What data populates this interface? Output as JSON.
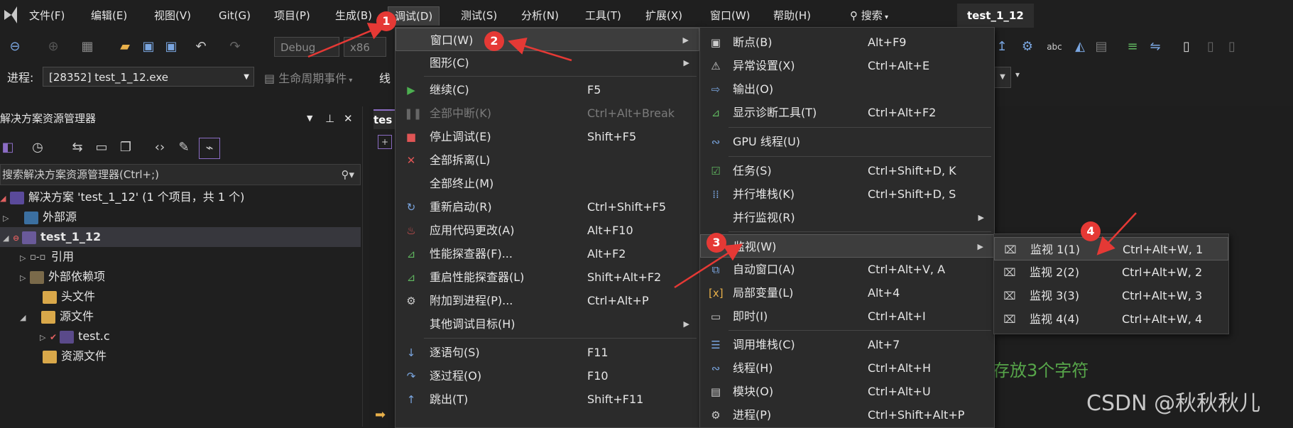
{
  "menubar": {
    "items": [
      "文件(F)",
      "编辑(E)",
      "视图(V)",
      "Git(G)",
      "项目(P)",
      "生成(B)",
      "调试(D)",
      "测试(S)",
      "分析(N)",
      "工具(T)",
      "扩展(X)",
      "窗口(W)",
      "帮助(H)"
    ],
    "search": "搜索",
    "project_title": "test_1_12"
  },
  "toolbar": {
    "config": "Debug",
    "platform": "x86",
    "process_label": "进程:",
    "process_value": "[28352] test_1_12.exe",
    "lifecycle": "生命周期事件",
    "thread_prefix": "线"
  },
  "solution_explorer": {
    "title": "解决方案资源管理器",
    "search_placeholder": "搜索解决方案资源管理器(Ctrl+;)",
    "items": [
      "解决方案 'test_1_12' (1 个项目，共 1 个)",
      "外部源",
      "test_1_12",
      "引用",
      "外部依赖项",
      "头文件",
      "源文件",
      "test.c",
      "资源文件"
    ]
  },
  "editor": {
    "tab_prefix": "tes",
    "comment_fragment": "存放3个字符"
  },
  "debug_menu": {
    "items": [
      {
        "label": "窗口(W)",
        "shortcut": ""
      },
      {
        "label": "图形(C)",
        "shortcut": ""
      },
      {
        "label": "继续(C)",
        "shortcut": "F5"
      },
      {
        "label": "全部中断(K)",
        "shortcut": "Ctrl+Alt+Break"
      },
      {
        "label": "停止调试(E)",
        "shortcut": "Shift+F5"
      },
      {
        "label": "全部拆离(L)",
        "shortcut": ""
      },
      {
        "label": "全部终止(M)",
        "shortcut": ""
      },
      {
        "label": "重新启动(R)",
        "shortcut": "Ctrl+Shift+F5"
      },
      {
        "label": "应用代码更改(A)",
        "shortcut": "Alt+F10"
      },
      {
        "label": "性能探查器(F)...",
        "shortcut": "Alt+F2"
      },
      {
        "label": "重启性能探查器(L)",
        "shortcut": "Shift+Alt+F2"
      },
      {
        "label": "附加到进程(P)...",
        "shortcut": "Ctrl+Alt+P"
      },
      {
        "label": "其他调试目标(H)",
        "shortcut": ""
      },
      {
        "label": "逐语句(S)",
        "shortcut": "F11"
      },
      {
        "label": "逐过程(O)",
        "shortcut": "F10"
      },
      {
        "label": "跳出(T)",
        "shortcut": "Shift+F11"
      }
    ]
  },
  "window_submenu": {
    "items": [
      {
        "label": "断点(B)",
        "shortcut": "Alt+F9"
      },
      {
        "label": "异常设置(X)",
        "shortcut": "Ctrl+Alt+E"
      },
      {
        "label": "输出(O)",
        "shortcut": ""
      },
      {
        "label": "显示诊断工具(T)",
        "shortcut": "Ctrl+Alt+F2"
      },
      {
        "label": "GPU 线程(U)",
        "shortcut": ""
      },
      {
        "label": "任务(S)",
        "shortcut": "Ctrl+Shift+D, K"
      },
      {
        "label": "并行堆栈(K)",
        "shortcut": "Ctrl+Shift+D, S"
      },
      {
        "label": "并行监视(R)",
        "shortcut": ""
      },
      {
        "label": "监视(W)",
        "shortcut": ""
      },
      {
        "label": "自动窗口(A)",
        "shortcut": "Ctrl+Alt+V, A"
      },
      {
        "label": "局部变量(L)",
        "shortcut": "Alt+4"
      },
      {
        "label": "即时(I)",
        "shortcut": "Ctrl+Alt+I"
      },
      {
        "label": "调用堆栈(C)",
        "shortcut": "Alt+7"
      },
      {
        "label": "线程(H)",
        "shortcut": "Ctrl+Alt+H"
      },
      {
        "label": "模块(O)",
        "shortcut": "Ctrl+Alt+U"
      },
      {
        "label": "进程(P)",
        "shortcut": "Ctrl+Shift+Alt+P"
      }
    ]
  },
  "watch_submenu": {
    "items": [
      {
        "label": "监视 1(1)",
        "shortcut": "Ctrl+Alt+W, 1"
      },
      {
        "label": "监视 2(2)",
        "shortcut": "Ctrl+Alt+W, 2"
      },
      {
        "label": "监视 3(3)",
        "shortcut": "Ctrl+Alt+W, 3"
      },
      {
        "label": "监视 4(4)",
        "shortcut": "Ctrl+Alt+W, 4"
      }
    ]
  },
  "annotations": {
    "badges": [
      "1",
      "2",
      "3",
      "4"
    ],
    "color": "#e53935"
  },
  "watermark": "CSDN @秋秋秋儿",
  "colors": {
    "accent": "#7aa6e0",
    "highlight": "#3d3d3d",
    "green": "#57a64a"
  }
}
